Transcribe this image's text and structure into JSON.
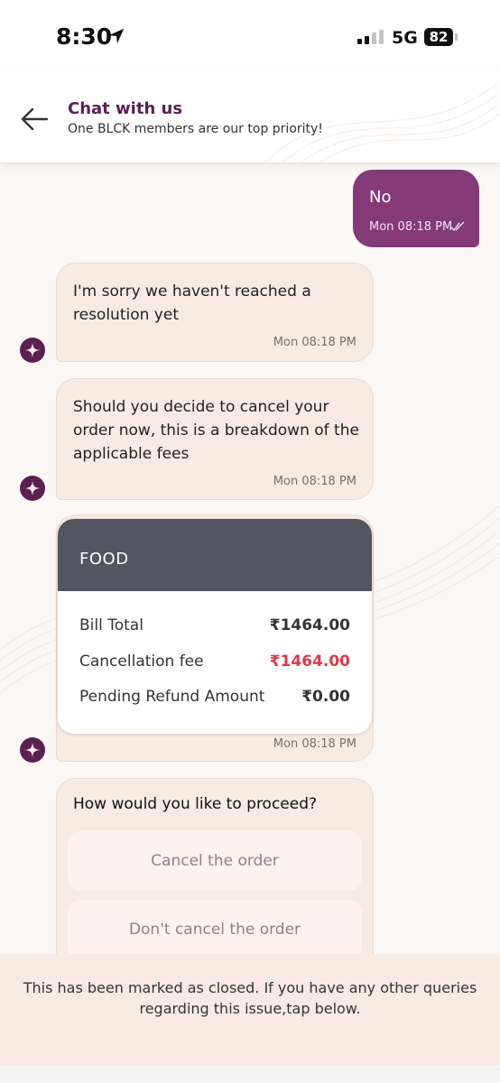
{
  "status_bar": {
    "time": "8:30",
    "network": "5G",
    "battery": "82",
    "location_icon": "location-arrow-icon",
    "signal_icon": "cellular-signal-icon"
  },
  "header": {
    "back_icon": "back-arrow-icon",
    "title": "Chat with us",
    "subtitle": "One BLCK members are our top priority!"
  },
  "messages": [
    {
      "sender": "user",
      "text": "No",
      "time": "Mon 08:18 PM",
      "status_icon": "double-check-icon"
    },
    {
      "sender": "bot",
      "text": "I'm sorry we haven't reached a resolution yet",
      "time": "Mon 08:18 PM"
    },
    {
      "sender": "bot",
      "text": "Should you decide to cancel your order now, this is a breakdown of the applicable fees",
      "time": "Mon 08:18 PM"
    },
    {
      "sender": "bot",
      "card": {
        "header": "FOOD",
        "rows": [
          {
            "label": "Bill Total",
            "value": "₹1464.00"
          },
          {
            "label": "Cancellation fee",
            "value": "₹1464.00"
          },
          {
            "label": "Pending Refund Amount",
            "value": "₹0.00"
          }
        ]
      },
      "time": "Mon 08:18 PM"
    },
    {
      "sender": "bot",
      "question": "How would you like to proceed?",
      "options": [
        "Cancel the order",
        "Don't cancel the order"
      ]
    }
  ],
  "closed_notice": "This has been marked as closed. If you have any other queries regarding this issue,tap below.",
  "colors": {
    "brand_purple": "#5b1f52",
    "user_bubble": "#833a77",
    "bot_bubble": "#f8ebe3",
    "card_header": "#535560",
    "fee_red": "#e0394a"
  }
}
